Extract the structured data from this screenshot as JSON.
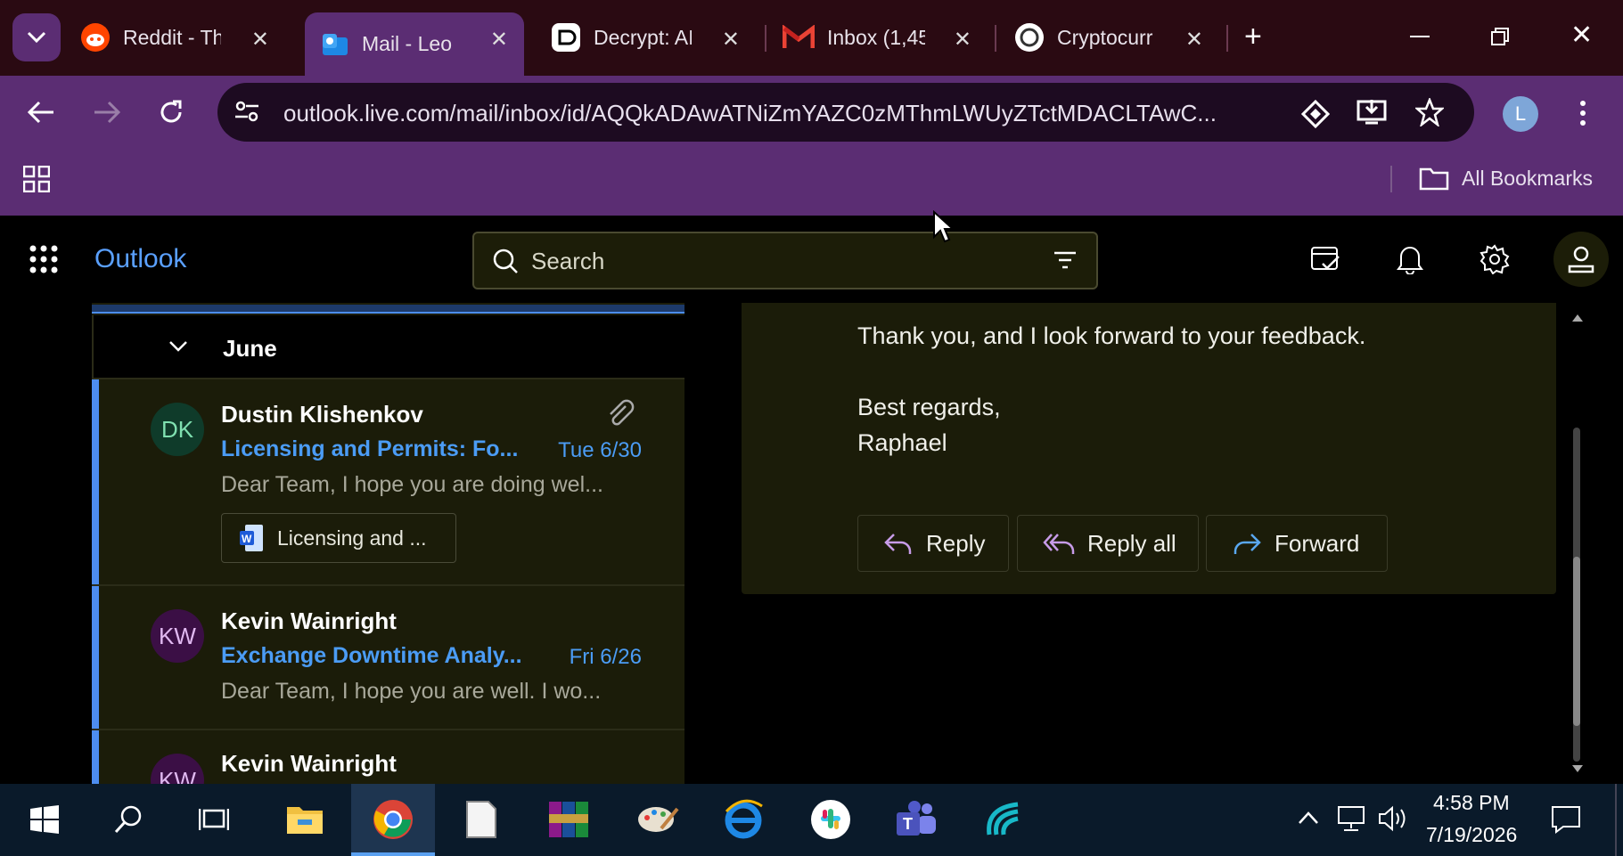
{
  "browser": {
    "tabs": [
      {
        "title": "Reddit - Th",
        "icon": "reddit-icon"
      },
      {
        "title": "Mail - Leo",
        "icon": "outlook-icon",
        "active": true
      },
      {
        "title": "Decrypt: AI",
        "icon": "decrypt-icon"
      },
      {
        "title": "Inbox (1,45",
        "icon": "gmail-icon"
      },
      {
        "title": "Cryptocurr",
        "icon": "chatgpt-icon"
      }
    ],
    "url": "outlook.live.com/mail/inbox/id/AQQkADAwATNiZmYAZC0zMThmLWUyZTctMDACLTAwC...",
    "profile_initial": "L",
    "bookmarks_label": "All Bookmarks"
  },
  "outlook": {
    "app_title": "Outlook",
    "search_placeholder": "Search",
    "group_label": "June",
    "emails": [
      {
        "sender": "Dustin Klishenkov",
        "initials": "DK",
        "subject": "Licensing and Permits: Fo...",
        "date": "Tue 6/30",
        "preview": "Dear Team, I hope you are doing wel...",
        "attachment": "Licensing and ...",
        "has_attachment": true,
        "avatar_color": "#0f3b2a",
        "avatar_text_color": "#7fe0b0"
      },
      {
        "sender": "Kevin Wainright",
        "initials": "KW",
        "subject": "Exchange Downtime Analy...",
        "date": "Fri 6/26",
        "preview": "Dear Team, I hope you are well. I wo...",
        "avatar_color": "#3b0f45",
        "avatar_text_color": "#e0b8f0"
      },
      {
        "sender": "Kevin Wainright",
        "initials": "KW",
        "avatar_color": "#3b0f45",
        "avatar_text_color": "#e0b8f0"
      }
    ],
    "reading": {
      "line1": "Thank you, and I look forward to your feedback.",
      "closing": "Best regards,",
      "signature": "Raphael"
    },
    "actions": {
      "reply": "Reply",
      "reply_all": "Reply all",
      "forward": "Forward"
    }
  },
  "taskbar": {
    "time": "4:58 PM",
    "date": "7/19/2026"
  }
}
